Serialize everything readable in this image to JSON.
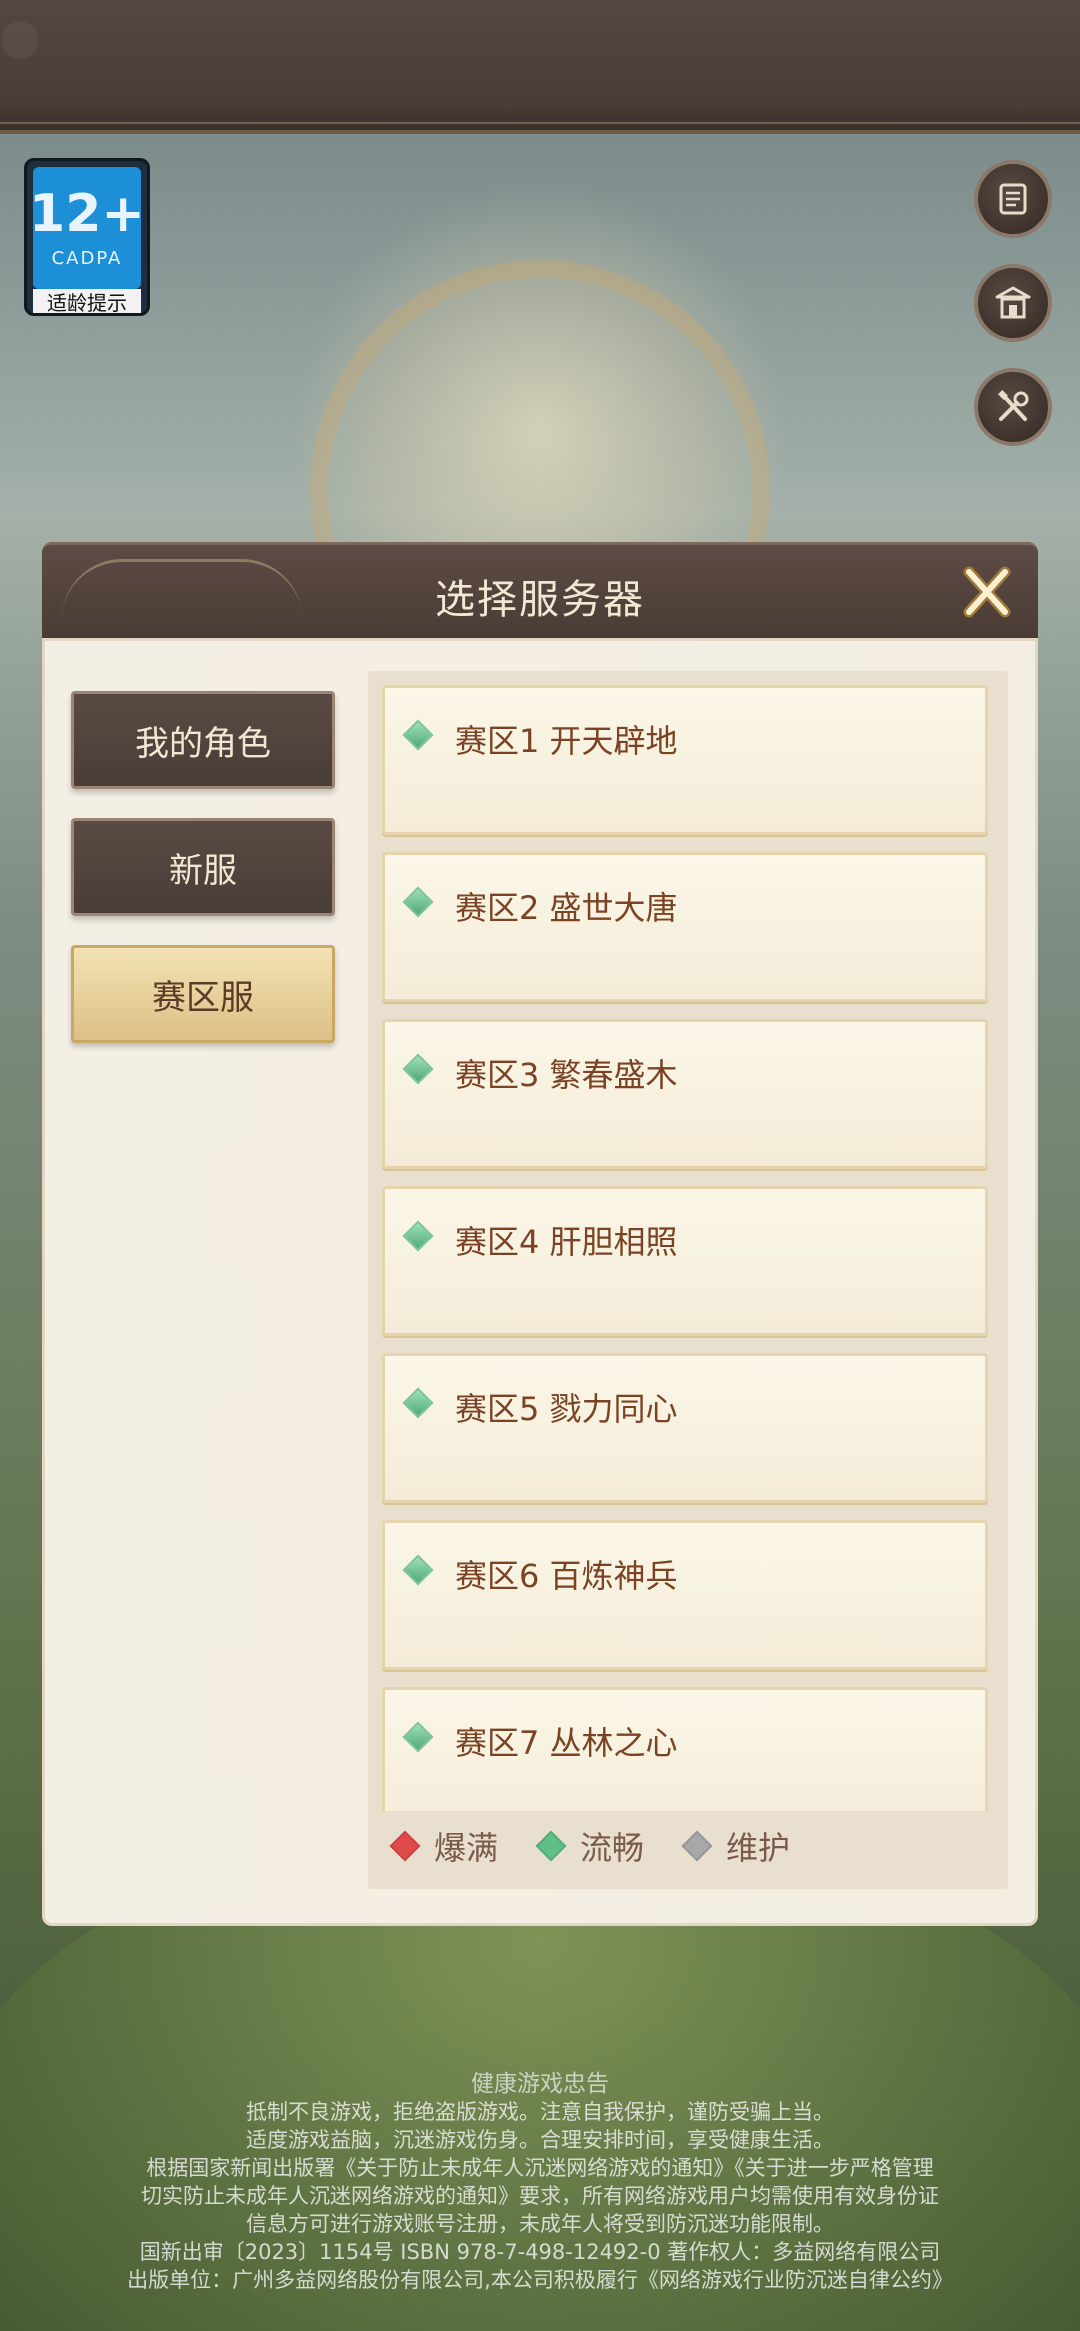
{
  "age_badge": {
    "number": "12+",
    "org": "CADPA",
    "label": "适龄提示"
  },
  "side_buttons": [
    {
      "icon": "scroll-icon"
    },
    {
      "icon": "pavilion-icon"
    },
    {
      "icon": "tools-icon"
    }
  ],
  "modal": {
    "title": "选择服务器",
    "tabs": [
      {
        "label": "我的角色",
        "active": false
      },
      {
        "label": "新服",
        "active": false
      },
      {
        "label": "赛区服",
        "active": true
      }
    ],
    "servers": [
      {
        "name": "赛区1 开天辟地",
        "status": "流畅"
      },
      {
        "name": "赛区2 盛世大唐",
        "status": "流畅"
      },
      {
        "name": "赛区3 繁春盛木",
        "status": "流畅"
      },
      {
        "name": "赛区4 肝胆相照",
        "status": "流畅"
      },
      {
        "name": "赛区5 戮力同心",
        "status": "流畅"
      },
      {
        "name": "赛区6 百炼神兵",
        "status": "流畅"
      },
      {
        "name": "赛区7 丛林之心",
        "status": "流畅"
      }
    ],
    "legend": [
      {
        "label": "爆满",
        "color": "#e04a4a"
      },
      {
        "label": "流畅",
        "color": "#5fbf86"
      },
      {
        "label": "维护",
        "color": "#a8a8a8"
      }
    ]
  },
  "colors": {
    "status_smooth": "#5fbf86",
    "status_full": "#e04a4a",
    "status_maintenance": "#a8a8a8",
    "server_name": "#7b4324"
  },
  "footer": {
    "title": "健康游戏忠告",
    "lines": [
      "抵制不良游戏，拒绝盗版游戏。注意自我保护，谨防受骗上当。",
      "适度游戏益脑，沉迷游戏伤身。合理安排时间，享受健康生活。",
      "根据国家新闻出版署《关于防止未成年人沉迷网络游戏的通知》《关于进一步严格管理",
      "切实防止未成年人沉迷网络游戏的通知》要求，所有网络游戏用户均需使用有效身份证",
      "信息方可进行游戏账号注册，未成年人将受到防沉迷功能限制。",
      "国新出审〔2023〕1154号 ISBN 978-7-498-12492-0 著作权人：多益网络有限公司",
      "出版单位：广州多益网络股份有限公司,本公司积极履行《网络游戏行业防沉迷自律公约》"
    ]
  }
}
